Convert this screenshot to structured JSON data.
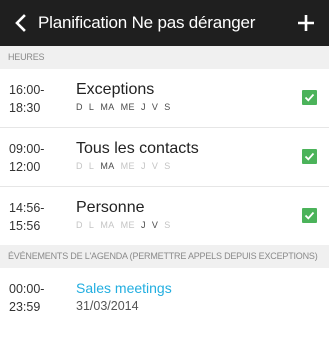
{
  "header": {
    "title": "Planification Ne pas déranger",
    "back_icon": "chevron-left-icon",
    "add_icon": "plus-icon"
  },
  "sections": {
    "hours": "HEURES",
    "calendar": "ÉVÉNEMENTS DE L'AGENDA (PERMETTRE APPELS DEPUIS EXCEPTIONS)"
  },
  "schedules": [
    {
      "start": "16:00-",
      "end": "18:30",
      "name": "Exceptions",
      "days": [
        {
          "label": "D",
          "active": true
        },
        {
          "label": "L",
          "active": true
        },
        {
          "label": "MA",
          "active": true
        },
        {
          "label": "ME",
          "active": true
        },
        {
          "label": "J",
          "active": true
        },
        {
          "label": "V",
          "active": true
        },
        {
          "label": "S",
          "active": true
        }
      ],
      "enabled": true
    },
    {
      "start": "09:00-",
      "end": "12:00",
      "name": "Tous les contacts",
      "days": [
        {
          "label": "D",
          "active": false
        },
        {
          "label": "L",
          "active": false
        },
        {
          "label": "MA",
          "active": true
        },
        {
          "label": "ME",
          "active": false
        },
        {
          "label": "J",
          "active": false
        },
        {
          "label": "V",
          "active": false
        },
        {
          "label": "S",
          "active": false
        }
      ],
      "enabled": true
    },
    {
      "start": "14:56-",
      "end": "15:56",
      "name": "Personne",
      "days": [
        {
          "label": "D",
          "active": false
        },
        {
          "label": "L",
          "active": false
        },
        {
          "label": "MA",
          "active": false
        },
        {
          "label": "ME",
          "active": false
        },
        {
          "label": "J",
          "active": true
        },
        {
          "label": "V",
          "active": true
        },
        {
          "label": "S",
          "active": false
        }
      ],
      "enabled": true
    }
  ],
  "events": [
    {
      "start": "00:00-",
      "end": "23:59",
      "name": "Sales meetings",
      "date": "31/03/2014"
    }
  ],
  "colors": {
    "header_bg": "#1f1f1f",
    "check_green": "#4bb35a",
    "event_blue": "#22aee0"
  }
}
